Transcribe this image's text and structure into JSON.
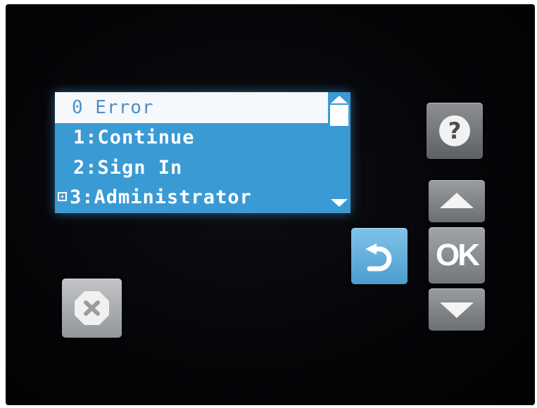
{
  "screen": {
    "title": "0 Error",
    "menu_items": [
      {
        "label": "1:Continue"
      },
      {
        "label": "2:Sign In"
      },
      {
        "label": "3:Administrator",
        "expandable": true
      }
    ]
  },
  "buttons": {
    "help_glyph": "?",
    "ok_label": "OK"
  },
  "icons": {
    "scroll_up": "triangle-up",
    "scroll_down": "triangle-down",
    "expand": "plus-box",
    "help": "question-mark",
    "up": "triangle-up",
    "down": "triangle-down",
    "back": "return-arrow",
    "cancel": "x-octagon"
  },
  "colors": {
    "lcd_background": "#3a9ad4",
    "lcd_highlight": "#f6f9fc",
    "highlight_text": "#4e8fc4",
    "back_button": "#5fb0de",
    "panel": "#050508"
  }
}
